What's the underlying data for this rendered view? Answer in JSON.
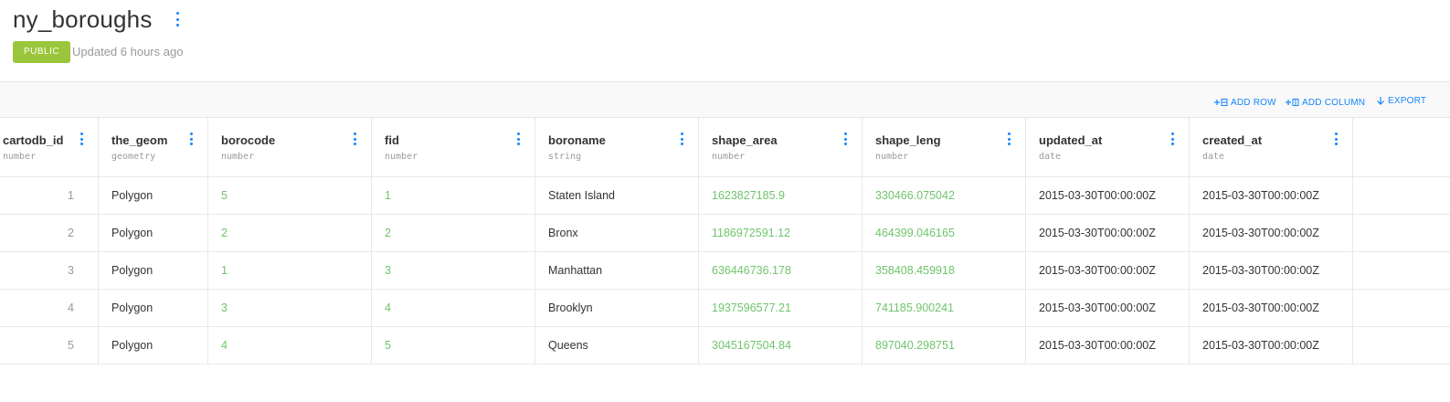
{
  "dataset": {
    "title": "ny_boroughs",
    "badge": "PUBLIC",
    "updated": "Updated 6 hours ago"
  },
  "toolbar": {
    "add_row": "ADD ROW",
    "add_column": "ADD COLUMN",
    "export": "EXPORT"
  },
  "columns": [
    {
      "name": "cartodb_id",
      "type": "number"
    },
    {
      "name": "the_geom",
      "type": "geometry"
    },
    {
      "name": "borocode",
      "type": "number"
    },
    {
      "name": "fid",
      "type": "number"
    },
    {
      "name": "boroname",
      "type": "string"
    },
    {
      "name": "shape_area",
      "type": "number"
    },
    {
      "name": "shape_leng",
      "type": "number"
    },
    {
      "name": "updated_at",
      "type": "date"
    },
    {
      "name": "created_at",
      "type": "date"
    }
  ],
  "rows": [
    [
      "1",
      "Polygon",
      "5",
      "1",
      "Staten Island",
      "1623827185.9",
      "330466.075042",
      "2015-03-30T00:00:00Z",
      "2015-03-30T00:00:00Z"
    ],
    [
      "2",
      "Polygon",
      "2",
      "2",
      "Bronx",
      "1186972591.12",
      "464399.046165",
      "2015-03-30T00:00:00Z",
      "2015-03-30T00:00:00Z"
    ],
    [
      "3",
      "Polygon",
      "1",
      "3",
      "Manhattan",
      "636446736.178",
      "358408.459918",
      "2015-03-30T00:00:00Z",
      "2015-03-30T00:00:00Z"
    ],
    [
      "4",
      "Polygon",
      "3",
      "4",
      "Brooklyn",
      "1937596577.21",
      "741185.900241",
      "2015-03-30T00:00:00Z",
      "2015-03-30T00:00:00Z"
    ],
    [
      "5",
      "Polygon",
      "4",
      "5",
      "Queens",
      "3045167504.84",
      "897040.298751",
      "2015-03-30T00:00:00Z",
      "2015-03-30T00:00:00Z"
    ]
  ],
  "colors": {
    "accent": "#1785fb",
    "badge": "#9bc63b",
    "number_value": "#6fc46b",
    "muted": "#999999"
  }
}
